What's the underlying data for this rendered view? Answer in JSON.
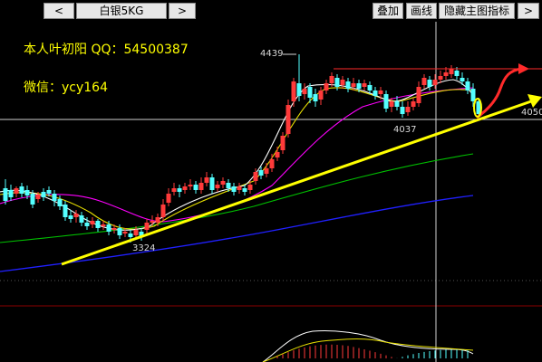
{
  "toolbar": {
    "prev_label": "<",
    "symbol": "白银5KG",
    "next_label": ">",
    "overlay_label": "叠加",
    "drawline_label": "画线",
    "hide_main_label": "隐藏主图指标",
    "more_label": ">"
  },
  "annotations": {
    "author_line": "本人叶初阳 QQ：54500387",
    "wechat_line": "微信：ycy164"
  },
  "chart_labels": {
    "high_marker": "4439",
    "low_marker": "3324",
    "mid_low_marker": "4037",
    "price_axis_value": "4050"
  },
  "colors": {
    "up": "#ff3a3a",
    "down": "#54ffff",
    "background": "#000000",
    "annotation": "#ffff00",
    "ma_white": "#ffffff",
    "ma_yellow": "#e8e000",
    "ma_magenta": "#ff00ff",
    "ma_green": "#00c000",
    "ma_blue": "#2020ff"
  },
  "icons": {
    "prev": "chevron-left-icon",
    "next": "chevron-right-icon",
    "more": "chevron-right-icon"
  }
}
